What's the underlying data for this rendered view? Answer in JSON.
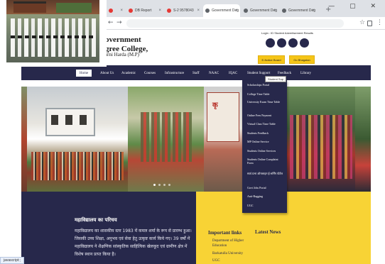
{
  "browser": {
    "tabs": [
      {
        "label": "",
        "active": false,
        "fav_color": "#e53935"
      },
      {
        "label": "DB Report",
        "active": false,
        "fav_color": "#e53935"
      },
      {
        "label": "S-2 9578043",
        "active": false,
        "fav_color": "#e53935"
      },
      {
        "label": "Government Deg",
        "active": true,
        "fav_color": "#5f6368"
      },
      {
        "label": "Government Deg",
        "active": false,
        "fav_color": "#5f6368"
      },
      {
        "label": "Government Deg",
        "active": false,
        "fav_color": "#5f6368"
      }
    ],
    "new_tab": "+",
    "window_controls": "— ▢ ✕",
    "nav_icons": [
      "←",
      "→",
      "↻",
      "⌂"
    ],
    "right_icons": [
      "☆",
      "⋮"
    ]
  },
  "site": {
    "college_name_line1": "overnment",
    "college_name_line2": "gree College,",
    "college_sub": "arni Harda (M.P)",
    "top_right_text": "Login : ID Student Advertisement Results",
    "circles_count": 4,
    "yellow_buttons": [
      "E-Notice Board",
      "Go Bhagalan"
    ],
    "nav": {
      "items": [
        "Home",
        "About Us",
        "Academic",
        "Courses",
        "Infrastructure",
        "Staff",
        "NAAC",
        "IQAC",
        "Student Support",
        "Feedback",
        "Library"
      ],
      "active_index": 0
    },
    "dropdown": {
      "tooltip": "Student Sup",
      "items": [
        "Scholarships Portal",
        "College Time Table",
        "University Exam Time Table",
        "Online Fees Payment",
        "Virtual Class Time Table",
        "Students Feedback",
        "MP Online Service",
        "Students Online Services",
        "Students Online Complaint Form",
        "स्वयं प्रभा ऑनलाइन ई-लर्निंग पोर्टल",
        "Govt Jobs Portal",
        "Anti-Ragging",
        "UGC"
      ]
    },
    "about": {
      "title": "महाविद्यालय का परिचय",
      "body": "महाविद्यालय का शासकीय स्तर 1983 में कमल शर्मा के रूप से प्रारम्भ हुआ। जिसकी उच्च शिक्षा, अनुभव एवं सेवा हेतु उत्कृष्ट कार्य किये गए। 39 वर्षों में महाविद्यालय ने शैक्षणिक सांस्कृतिक साहित्यिक खेलकूद एवं ग्रामीण क्षेत्र में विशेष स्थान प्राप्त किया है।"
    },
    "important_links": {
      "title": "Important links",
      "items": [
        "Department of Higher Education",
        "Barkatulla University",
        "UGC"
      ]
    },
    "latest_news": {
      "title": "Latest News"
    },
    "status_text": "javascript:;"
  },
  "theme": {
    "navy": "#27284b",
    "yellow": "#f8d335",
    "accent_yellow": "#f5c518"
  }
}
